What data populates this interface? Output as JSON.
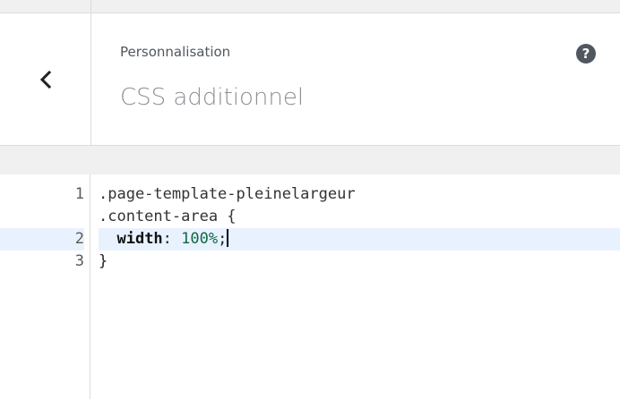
{
  "header": {
    "breadcrumb": "Personnalisation",
    "title": "CSS additionnel",
    "back_icon": "chevron-left-icon",
    "help_icon": "question-mark-icon",
    "help_symbol": "?"
  },
  "editor": {
    "lines": [
      {
        "number": "1",
        "text_a": ".page-template-pleinelargeur",
        "text_b": ".content-area {"
      },
      {
        "number": "2",
        "prop": "width",
        "value": "100%",
        "colon": ": ",
        "end": ";"
      },
      {
        "number": "3",
        "text": "}"
      }
    ]
  }
}
